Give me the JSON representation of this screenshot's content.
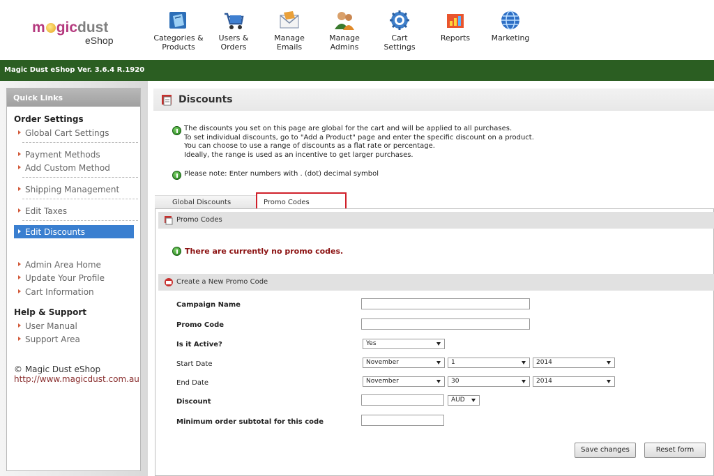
{
  "logo": {
    "magic": "magic",
    "dust": "dust",
    "eshop": "eShop"
  },
  "nav": [
    {
      "label": "Categories &",
      "label2": "Products",
      "icon": "categories-products-icon"
    },
    {
      "label": "Users &",
      "label2": "Orders",
      "icon": "users-orders-icon"
    },
    {
      "label": "Manage",
      "label2": "Emails",
      "icon": "manage-emails-icon"
    },
    {
      "label": "Manage",
      "label2": "Admins",
      "icon": "manage-admins-icon"
    },
    {
      "label": "Cart",
      "label2": "Settings",
      "icon": "cart-settings-icon"
    },
    {
      "label": "Reports",
      "label2": "",
      "icon": "reports-icon"
    },
    {
      "label": "Marketing",
      "label2": "",
      "icon": "marketing-icon"
    }
  ],
  "version": "Magic Dust eShop Ver. 3.6.4 R.1920",
  "sidebar": {
    "title": "Quick Links",
    "order_settings": "Order Settings",
    "links": {
      "global_cart": "Global Cart Settings",
      "payment_methods": "Payment Methods",
      "add_custom_method": "Add Custom Method",
      "shipping": "Shipping Management",
      "edit_taxes": "Edit Taxes",
      "edit_discounts": "Edit Discounts",
      "admin_home": "Admin Area Home",
      "update_profile": "Update Your Profile",
      "cart_info": "Cart Information",
      "user_manual": "User Manual",
      "support_area": "Support Area"
    },
    "help_support": "Help & Support",
    "copyright": "© Magic Dust eShop",
    "url": "http://www.magicdust.com.au"
  },
  "main": {
    "title": "Discounts",
    "info_lines": [
      "The discounts you set on this page are global for the cart and will be applied to all purchases.",
      "To set individual discounts, go to \"Add a Product\" page and enter the specific discount on a product.",
      "You can choose to use a range of discounts as a flat rate or percentage.",
      "Ideally, the range is used as an incentive to get larger purchases."
    ],
    "note": "Please note: Enter numbers with . (dot) decimal symbol",
    "tabs": {
      "global": "Global Discounts",
      "promo": "Promo Codes"
    },
    "promo_section": "Promo Codes",
    "empty_message": "There are currently no promo codes.",
    "create_section": "Create a New Promo Code",
    "form": {
      "campaign_name": "Campaign Name",
      "promo_code": "Promo Code",
      "is_active": "Is it Active?",
      "is_active_value": "Yes",
      "start_date": "Start Date",
      "start_month": "November",
      "start_day": "1",
      "start_year": "2014",
      "end_date": "End Date",
      "end_month": "November",
      "end_day": "30",
      "end_year": "2014",
      "discount": "Discount",
      "currency": "AUD",
      "min_subtotal": "Minimum order subtotal for this code"
    },
    "buttons": {
      "save": "Save changes",
      "reset": "Reset form"
    }
  },
  "colors": {
    "green_bar": "#2b5e22",
    "active_link": "#3a7fd0",
    "tab_highlight": "#d0202a",
    "empty_msg": "#8b1111"
  }
}
